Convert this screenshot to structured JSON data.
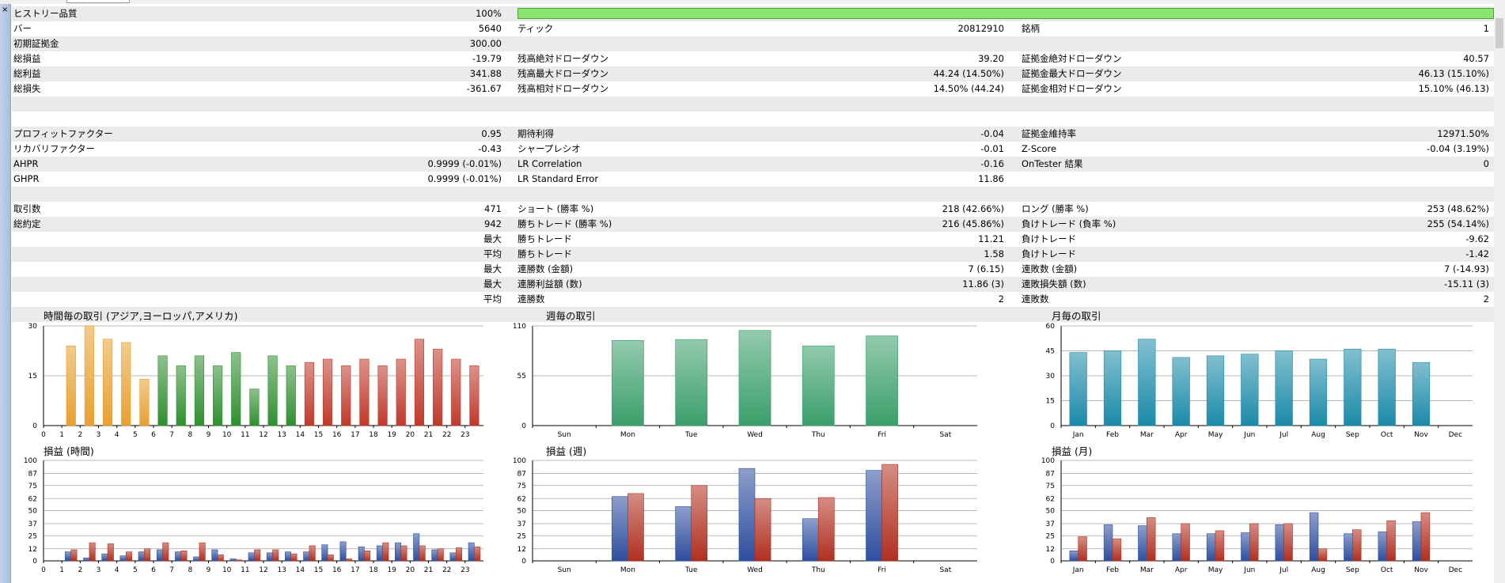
{
  "window": {
    "close_glyph": "×"
  },
  "stats_rows": [
    {
      "shade": true,
      "quality": true,
      "c": [
        {
          "l": "ヒストリー品質",
          "v": "100%"
        }
      ]
    },
    {
      "shade": false,
      "c": [
        {
          "l": "バー",
          "v": "5640"
        },
        {
          "l": "ティック",
          "v": "20812910"
        },
        {
          "l": "銘柄",
          "v": "1"
        }
      ]
    },
    {
      "shade": true,
      "c": [
        {
          "l": "初期証拠金",
          "v": "300.00"
        }
      ]
    },
    {
      "shade": false,
      "c": [
        {
          "l": "総損益",
          "v": "-19.79"
        },
        {
          "l": "残高絶対ドローダウン",
          "v": "39.20"
        },
        {
          "l": "証拠金絶対ドローダウン",
          "v": "40.57"
        }
      ]
    },
    {
      "shade": true,
      "c": [
        {
          "l": "総利益",
          "v": "341.88"
        },
        {
          "l": "残高最大ドローダウン",
          "v": "44.24 (14.50%)"
        },
        {
          "l": "証拠金最大ドローダウン",
          "v": "46.13 (15.10%)"
        }
      ]
    },
    {
      "shade": false,
      "c": [
        {
          "l": "総損失",
          "v": "-361.67"
        },
        {
          "l": "残高相対ドローダウン",
          "v": "14.50% (44.24)"
        },
        {
          "l": "証拠金相対ドローダウン",
          "v": "15.10% (46.13)"
        }
      ]
    },
    {
      "shade": true,
      "c": []
    },
    {
      "shade": false,
      "c": []
    },
    {
      "shade": true,
      "c": [
        {
          "l": "プロフィットファクター",
          "v": "0.95"
        },
        {
          "l": "期待利得",
          "v": "-0.04"
        },
        {
          "l": "証拠金維持率",
          "v": "12971.50%"
        }
      ]
    },
    {
      "shade": false,
      "c": [
        {
          "l": "リカバリファクター",
          "v": "-0.43"
        },
        {
          "l": "シャープレシオ",
          "v": "-0.01"
        },
        {
          "l": "Z-Score",
          "v": "-0.04 (3.19%)"
        }
      ]
    },
    {
      "shade": true,
      "c": [
        {
          "l": "AHPR",
          "v": "0.9999 (-0.01%)"
        },
        {
          "l": "LR Correlation",
          "v": "-0.16"
        },
        {
          "l": "OnTester 結果",
          "v": "0"
        }
      ]
    },
    {
      "shade": false,
      "c": [
        {
          "l": "GHPR",
          "v": "0.9999 (-0.01%)"
        },
        {
          "l": "LR Standard Error",
          "v": "11.86"
        }
      ]
    },
    {
      "shade": true,
      "c": []
    },
    {
      "shade": false,
      "c": [
        {
          "l": "取引数",
          "v": "471"
        },
        {
          "l": "ショート (勝率 %)",
          "v": "218 (42.66%)"
        },
        {
          "l": "ロング (勝率 %)",
          "v": "253 (48.62%)"
        }
      ]
    },
    {
      "shade": true,
      "c": [
        {
          "l": "総約定",
          "v": "942"
        },
        {
          "l": "勝ちトレード (勝率 %)",
          "v": "216 (45.86%)"
        },
        {
          "l": "負けトレード (負率 %)",
          "v": "255 (54.14%)"
        }
      ]
    },
    {
      "shade": false,
      "c": [
        {
          "l": "",
          "v": "最大"
        },
        {
          "l": "勝ちトレード",
          "v": "11.21"
        },
        {
          "l": "負けトレード",
          "v": "-9.62"
        }
      ]
    },
    {
      "shade": true,
      "c": [
        {
          "l": "",
          "v": "平均"
        },
        {
          "l": "勝ちトレード",
          "v": "1.58"
        },
        {
          "l": "負けトレード",
          "v": "-1.42"
        }
      ]
    },
    {
      "shade": false,
      "c": [
        {
          "l": "",
          "v": "最大"
        },
        {
          "l": "連勝数 (金額)",
          "v": "7 (6.15)"
        },
        {
          "l": "連敗数 (金額)",
          "v": "7 (-14.93)"
        }
      ]
    },
    {
      "shade": true,
      "c": [
        {
          "l": "",
          "v": "最大"
        },
        {
          "l": "連勝利益額 (数)",
          "v": "11.86 (3)"
        },
        {
          "l": "連敗損失額 (数)",
          "v": "-15.11 (3)"
        }
      ]
    },
    {
      "shade": false,
      "c": [
        {
          "l": "",
          "v": "平均"
        },
        {
          "l": "連勝数",
          "v": "2"
        },
        {
          "l": "連敗数",
          "v": "2"
        }
      ]
    },
    {
      "shade": true,
      "c": []
    }
  ],
  "chart_data": [
    {
      "id": "hour-trades",
      "type": "bar",
      "title": "時間毎の取引 (アジア,ヨーロッパ,アメリカ)",
      "ylim": [
        0,
        30
      ],
      "yticks": [
        0,
        15,
        30
      ],
      "categories": [
        "0",
        "1",
        "2",
        "3",
        "4",
        "5",
        "6",
        "7",
        "8",
        "9",
        "10",
        "11",
        "12",
        "13",
        "14",
        "15",
        "16",
        "17",
        "18",
        "19",
        "20",
        "21",
        "22",
        "23"
      ],
      "values": [
        0,
        24,
        30,
        26,
        25,
        14,
        21,
        18,
        21,
        18,
        22,
        11,
        21,
        18,
        19,
        20,
        18,
        20,
        18,
        20,
        26,
        23,
        20,
        18
      ],
      "colors": [
        "#e8a030",
        "#e8a030",
        "#e8a030",
        "#e8a030",
        "#e8a030",
        "#e8a030",
        "#2f8f2f",
        "#2f8f2f",
        "#2f8f2f",
        "#2f8f2f",
        "#2f8f2f",
        "#2f8f2f",
        "#2f8f2f",
        "#2f8f2f",
        "#c0392b",
        "#c0392b",
        "#c0392b",
        "#c0392b",
        "#c0392b",
        "#c0392b",
        "#c0392b",
        "#c0392b",
        "#c0392b",
        "#c0392b"
      ],
      "grid": true
    },
    {
      "id": "week-trades",
      "type": "bar",
      "title": "週毎の取引",
      "ylim": [
        0,
        110
      ],
      "yticks": [
        0,
        55,
        110
      ],
      "categories": [
        "Sun",
        "Mon",
        "Tue",
        "Wed",
        "Thu",
        "Fri",
        "Sat"
      ],
      "values": [
        0,
        94,
        95,
        105,
        88,
        99,
        0
      ],
      "colors": [
        "#3a9f6a"
      ],
      "grid": true
    },
    {
      "id": "month-trades",
      "type": "bar",
      "title": "月毎の取引",
      "ylim": [
        0,
        60
      ],
      "yticks": [
        0,
        15,
        30,
        45,
        60
      ],
      "categories": [
        "Jan",
        "Feb",
        "Mar",
        "Apr",
        "May",
        "Jun",
        "Jul",
        "Aug",
        "Sep",
        "Oct",
        "Nov",
        "Dec"
      ],
      "values": [
        44,
        45,
        52,
        41,
        42,
        43,
        45,
        40,
        46,
        46,
        38,
        0
      ],
      "colors": [
        "#1b8aa8"
      ],
      "grid": true
    },
    {
      "id": "hour-pl",
      "type": "bar",
      "title": "損益 (時間)",
      "ylim": [
        0,
        100
      ],
      "yticks": [
        0,
        12,
        25,
        37,
        50,
        62,
        75,
        87,
        100
      ],
      "categories": [
        "0",
        "1",
        "2",
        "3",
        "4",
        "5",
        "6",
        "7",
        "8",
        "9",
        "10",
        "11",
        "12",
        "13",
        "14",
        "15",
        "16",
        "17",
        "18",
        "19",
        "20",
        "21",
        "22",
        "23"
      ],
      "series": [
        {
          "values": [
            0,
            9,
            3,
            7,
            5,
            9,
            11,
            9,
            4,
            11,
            2,
            8,
            8,
            9,
            9,
            16,
            19,
            14,
            15,
            18,
            27,
            11,
            8,
            18
          ],
          "color": "#2e4f9e"
        },
        {
          "values": [
            0,
            11,
            18,
            17,
            9,
            12,
            18,
            10,
            18,
            6,
            1,
            11,
            11,
            7,
            15,
            6,
            2,
            10,
            18,
            15,
            15,
            12,
            13,
            14
          ],
          "color": "#b03020"
        }
      ],
      "grid": true
    },
    {
      "id": "week-pl",
      "type": "bar",
      "title": "損益 (週)",
      "ylim": [
        0,
        100
      ],
      "yticks": [
        0,
        12,
        25,
        37,
        50,
        62,
        75,
        87,
        100
      ],
      "categories": [
        "Sun",
        "Mon",
        "Tue",
        "Wed",
        "Thu",
        "Fri",
        "Sat"
      ],
      "series": [
        {
          "values": [
            0,
            64,
            54,
            92,
            42,
            90,
            0
          ],
          "color": "#2e4f9e"
        },
        {
          "values": [
            0,
            67,
            75,
            62,
            63,
            96,
            0
          ],
          "color": "#b03020"
        }
      ],
      "grid": true
    },
    {
      "id": "month-pl",
      "type": "bar",
      "title": "損益 (月)",
      "ylim": [
        0,
        100
      ],
      "yticks": [
        0,
        12,
        25,
        37,
        50,
        62,
        75,
        87,
        100
      ],
      "categories": [
        "Jan",
        "Feb",
        "Mar",
        "Apr",
        "May",
        "Jun",
        "Jul",
        "Aug",
        "Sep",
        "Oct",
        "Nov",
        "Dec"
      ],
      "series": [
        {
          "values": [
            10,
            36,
            35,
            27,
            27,
            28,
            36,
            48,
            27,
            29,
            39,
            0
          ],
          "color": "#2e4f9e"
        },
        {
          "values": [
            24,
            22,
            43,
            37,
            30,
            37,
            37,
            12,
            31,
            40,
            48,
            0
          ],
          "color": "#b03020"
        }
      ],
      "grid": true
    }
  ]
}
